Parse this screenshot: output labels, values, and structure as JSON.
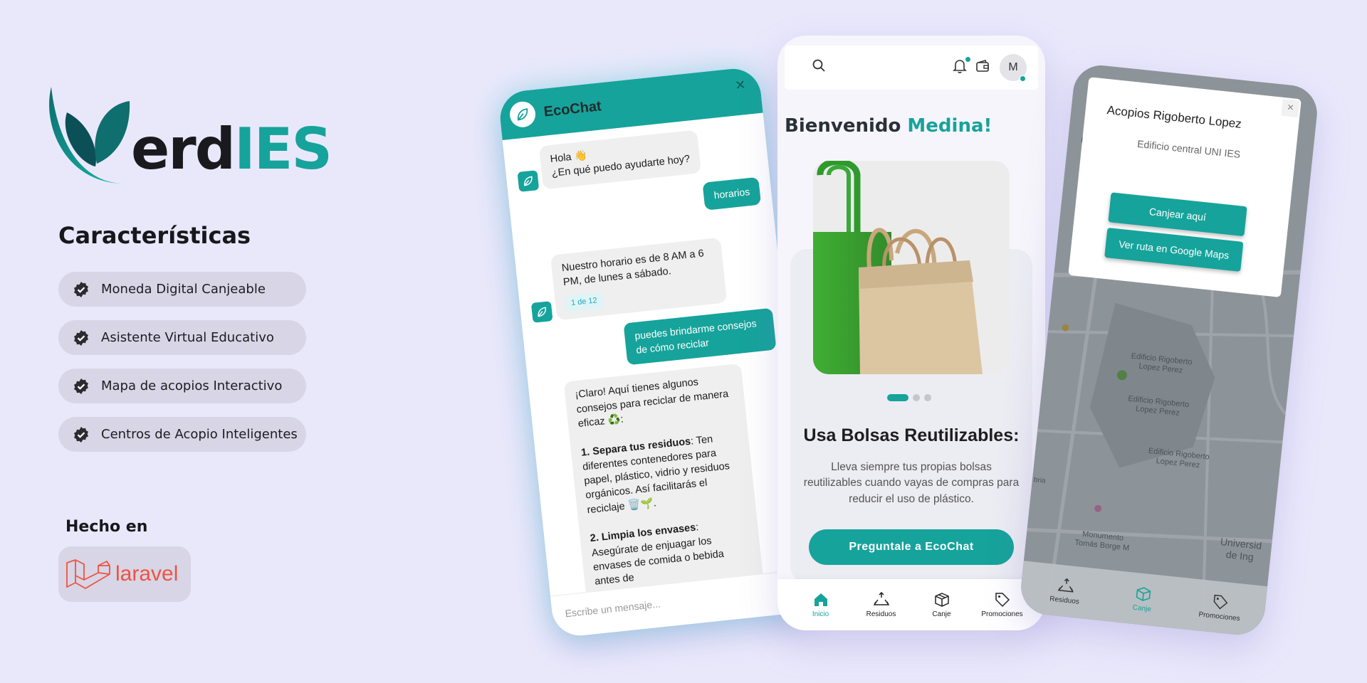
{
  "brand": {
    "logo_dark": "erd",
    "logo_teal": "IES",
    "accent": "#16a39b"
  },
  "features": {
    "title": "Características",
    "items": [
      "Moneda Digital Canjeable",
      "Asistente Virtual Educativo",
      "Mapa de acopios Interactivo",
      "Centros de Acopio Inteligentes"
    ]
  },
  "made_in": {
    "label": "Hecho en",
    "framework": "laravel"
  },
  "chat": {
    "title": "EcoChat",
    "close": "✕",
    "messages": {
      "greet_1": "Hola 👋",
      "greet_2": "¿En qué puedo ayudarte hoy?",
      "user_1": "horarios",
      "bot_hours": "Nuestro horario es de 8 AM a 6 PM, de lunes a sábado.",
      "pager": "1 de 12",
      "user_2": "puedes brindarme consejos de cómo reciclar",
      "bot_intro": "¡Claro! Aquí tienes algunos consejos para reciclar de manera eficaz ♻️:",
      "tip1_title": "1. Separa tus residuos",
      "tip1_text": ": Ten diferentes contenedores para papel, plástico, vidrio y residuos orgánicos. Así facilitarás el reciclaje 🗑️🌱.",
      "tip2_title": "2. Limpia los envases",
      "tip2_text": ": Asegúrate de enjuagar los envases de comida o bebida antes de"
    },
    "input_placeholder": "Escribe un mensaje..."
  },
  "home": {
    "avatar_letter": "M",
    "welcome": "Bienvenido",
    "user_name": "Medina!",
    "tip_title": "Usa Bolsas Reutilizables:",
    "tip_text": "Lleva siempre tus propias bolsas reutilizables cuando vayas de compras para reducir el uso de plástico.",
    "cta": "Preguntale a EcoChat",
    "nav": [
      "Inicio",
      "Residuos",
      "Canje",
      "Promociones"
    ]
  },
  "map": {
    "popup_title": "Acopios Rigoberto Lopez",
    "popup_sub": "Edificio central UNI IES",
    "close": "×",
    "btn_redeem": "Canjear aquí",
    "btn_route": "Ver ruta en Google Maps",
    "labels": {
      "b1": "Edificio Rigoberto Lopez Perez",
      "b2": "Edificio Rigoberto Lopez Perez",
      "b3": "Edificio Rigoberto Lopez Perez",
      "monumento": "Monumento Tomás Borge M",
      "univ": "Universid de Ing",
      "corner": "C",
      "side": "bria"
    },
    "nav": [
      "Residuos",
      "Canje",
      "Promociones"
    ]
  }
}
